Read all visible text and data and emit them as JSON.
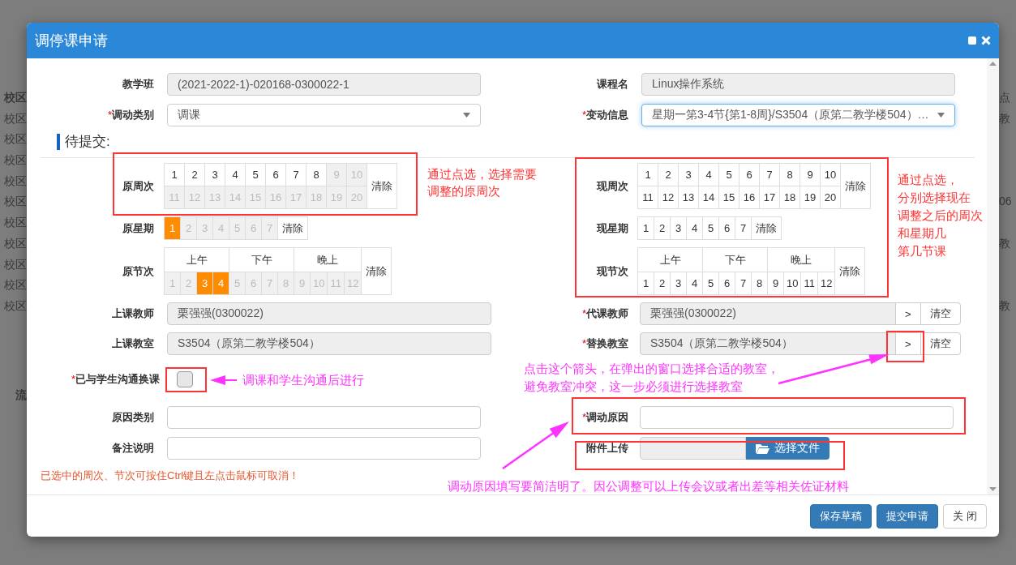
{
  "backdrop": {
    "left_header": "校区",
    "left_rows": [
      "校区",
      "校区",
      "校区",
      "校区",
      "校区",
      "校区",
      "校区",
      "校区",
      "校区",
      "校区"
    ],
    "left_bottom": "流",
    "right_header": "点",
    "right_rows": [
      "教",
      "06",
      "教",
      "教"
    ]
  },
  "dialog": {
    "title": "调停课申请"
  },
  "top_fields": [
    {
      "label": "教学班",
      "kind": "readonly",
      "value": "(2021-2022-1)-020168-0300022-1"
    },
    {
      "label": "课程名",
      "kind": "readonly",
      "value": "Linux操作系统"
    },
    {
      "label": "调动类别",
      "mark": "*",
      "kind": "select",
      "value": "调课",
      "focused": false
    },
    {
      "label": "变动信息",
      "mark": "*",
      "kind": "select",
      "value": "星期一第3-4节{第1-8周}/S3504（原第二教学楼504）…",
      "focused": true
    }
  ],
  "section_title": "待提交:",
  "original": {
    "weeks": {
      "label": "原周次",
      "clear": "清除",
      "items": [
        {
          "label": "1",
          "selected": false,
          "disabled": false
        },
        {
          "label": "2",
          "selected": false,
          "disabled": false
        },
        {
          "label": "3",
          "selected": false,
          "disabled": false
        },
        {
          "label": "4",
          "selected": false,
          "disabled": false
        },
        {
          "label": "5",
          "selected": false,
          "disabled": false
        },
        {
          "label": "6",
          "selected": false,
          "disabled": false
        },
        {
          "label": "7",
          "selected": false,
          "disabled": false
        },
        {
          "label": "8",
          "selected": false,
          "disabled": false
        },
        {
          "label": "9",
          "selected": false,
          "disabled": true
        },
        {
          "label": "10",
          "selected": false,
          "disabled": true
        },
        {
          "label": "11",
          "selected": false,
          "disabled": true
        },
        {
          "label": "12",
          "selected": false,
          "disabled": true
        },
        {
          "label": "13",
          "selected": false,
          "disabled": true
        },
        {
          "label": "14",
          "selected": false,
          "disabled": true
        },
        {
          "label": "15",
          "selected": false,
          "disabled": true
        },
        {
          "label": "16",
          "selected": false,
          "disabled": true
        },
        {
          "label": "17",
          "selected": false,
          "disabled": true
        },
        {
          "label": "18",
          "selected": false,
          "disabled": true
        },
        {
          "label": "19",
          "selected": false,
          "disabled": true
        },
        {
          "label": "20",
          "selected": false,
          "disabled": true
        }
      ]
    },
    "weekday": {
      "label": "原星期",
      "clear": "清除",
      "items": [
        {
          "label": "1",
          "selected": true,
          "disabled": false
        },
        {
          "label": "2",
          "selected": false,
          "disabled": true
        },
        {
          "label": "3",
          "selected": false,
          "disabled": true
        },
        {
          "label": "4",
          "selected": false,
          "disabled": true
        },
        {
          "label": "5",
          "selected": false,
          "disabled": true
        },
        {
          "label": "6",
          "selected": false,
          "disabled": true
        },
        {
          "label": "7",
          "selected": false,
          "disabled": true
        }
      ]
    },
    "periods": {
      "label": "原节次",
      "clear": "清除",
      "groups": [
        "上午",
        "下午",
        "晚上"
      ],
      "items": [
        {
          "label": "1",
          "selected": false,
          "disabled": true
        },
        {
          "label": "2",
          "selected": false,
          "disabled": true
        },
        {
          "label": "3",
          "selected": true,
          "disabled": false
        },
        {
          "label": "4",
          "selected": true,
          "disabled": false
        },
        {
          "label": "5",
          "selected": false,
          "disabled": true
        },
        {
          "label": "6",
          "selected": false,
          "disabled": true
        },
        {
          "label": "7",
          "selected": false,
          "disabled": true
        },
        {
          "label": "8",
          "selected": false,
          "disabled": true
        },
        {
          "label": "9",
          "selected": false,
          "disabled": true
        },
        {
          "label": "10",
          "selected": false,
          "disabled": true
        },
        {
          "label": "11",
          "selected": false,
          "disabled": true
        },
        {
          "label": "12",
          "selected": false,
          "disabled": true
        }
      ]
    }
  },
  "new": {
    "weeks": {
      "label": "现周次",
      "clear": "清除",
      "items": [
        {
          "label": "1",
          "selected": false,
          "disabled": false
        },
        {
          "label": "2",
          "selected": false,
          "disabled": false
        },
        {
          "label": "3",
          "selected": false,
          "disabled": false
        },
        {
          "label": "4",
          "selected": false,
          "disabled": false
        },
        {
          "label": "5",
          "selected": false,
          "disabled": false
        },
        {
          "label": "6",
          "selected": false,
          "disabled": false
        },
        {
          "label": "7",
          "selected": false,
          "disabled": false
        },
        {
          "label": "8",
          "selected": false,
          "disabled": false
        },
        {
          "label": "9",
          "selected": false,
          "disabled": false
        },
        {
          "label": "10",
          "selected": false,
          "disabled": false
        },
        {
          "label": "11",
          "selected": false,
          "disabled": false
        },
        {
          "label": "12",
          "selected": false,
          "disabled": false
        },
        {
          "label": "13",
          "selected": false,
          "disabled": false
        },
        {
          "label": "14",
          "selected": false,
          "disabled": false
        },
        {
          "label": "15",
          "selected": false,
          "disabled": false
        },
        {
          "label": "16",
          "selected": false,
          "disabled": false
        },
        {
          "label": "17",
          "selected": false,
          "disabled": false
        },
        {
          "label": "18",
          "selected": false,
          "disabled": false
        },
        {
          "label": "19",
          "selected": false,
          "disabled": false
        },
        {
          "label": "20",
          "selected": false,
          "disabled": false
        }
      ]
    },
    "weekday": {
      "label": "现星期",
      "clear": "清除",
      "items": [
        {
          "label": "1",
          "selected": false,
          "disabled": false
        },
        {
          "label": "2",
          "selected": false,
          "disabled": false
        },
        {
          "label": "3",
          "selected": false,
          "disabled": false
        },
        {
          "label": "4",
          "selected": false,
          "disabled": false
        },
        {
          "label": "5",
          "selected": false,
          "disabled": false
        },
        {
          "label": "6",
          "selected": false,
          "disabled": false
        },
        {
          "label": "7",
          "selected": false,
          "disabled": false
        }
      ]
    },
    "periods": {
      "label": "现节次",
      "clear": "清除",
      "groups": [
        "上午",
        "下午",
        "晚上"
      ],
      "items": [
        {
          "label": "1",
          "selected": false,
          "disabled": false
        },
        {
          "label": "2",
          "selected": false,
          "disabled": false
        },
        {
          "label": "3",
          "selected": false,
          "disabled": false
        },
        {
          "label": "4",
          "selected": false,
          "disabled": false
        },
        {
          "label": "5",
          "selected": false,
          "disabled": false
        },
        {
          "label": "6",
          "selected": false,
          "disabled": false
        },
        {
          "label": "7",
          "selected": false,
          "disabled": false
        },
        {
          "label": "8",
          "selected": false,
          "disabled": false
        },
        {
          "label": "9",
          "selected": false,
          "disabled": false
        },
        {
          "label": "10",
          "selected": false,
          "disabled": false
        },
        {
          "label": "11",
          "selected": false,
          "disabled": false
        },
        {
          "label": "12",
          "selected": false,
          "disabled": false
        }
      ]
    }
  },
  "people_fields": [
    {
      "label": "上课教师",
      "kind": "readonly",
      "value": "栗强强(0300022)"
    },
    {
      "label": "代课教师",
      "mark": "*",
      "kind": "picker",
      "value": "栗强强(0300022)",
      "pick": ">",
      "clear": "清空"
    },
    {
      "label": "上课教室",
      "kind": "readonly",
      "value": "S3504（原第二教学楼504）"
    },
    {
      "label": "替换教室",
      "mark": "*",
      "kind": "picker",
      "value": "S3504（原第二教学楼504）",
      "pick": ">",
      "clear": "清空"
    }
  ],
  "confirm": {
    "label": "已与学生沟通换课",
    "mark": "*",
    "checked": false
  },
  "reason_fields": [
    {
      "label": "原因类别",
      "kind": "input"
    },
    {
      "label": "调动原因",
      "mark": "*",
      "kind": "input"
    },
    {
      "label": "备注说明",
      "kind": "input"
    },
    {
      "label": "附件上传",
      "kind": "file",
      "button": "选择文件"
    }
  ],
  "note": "已选中的周次、节次可按住Ctrl键且左点击鼠标可取消！",
  "buttons": [
    {
      "label": "保存草稿",
      "kind": "primary"
    },
    {
      "label": "提交申请",
      "kind": "primary"
    },
    {
      "label": "关 闭",
      "kind": "default"
    }
  ],
  "annotations": [
    {
      "lines": [
        "通过点选，选择需要",
        "调整的原周次"
      ],
      "color": "#ff3333"
    },
    {
      "lines": [
        "通过点选，",
        "分别选择现在",
        "调整之后的周次",
        "和星期几",
        "第几节课"
      ],
      "color": "#ff3333"
    },
    {
      "lines": [
        "调课和学生沟通后进行"
      ],
      "color": "#ff33ff"
    },
    {
      "lines": [
        "点击这个箭头，在弹出的窗口选择合适的教室，",
        "避免教室冲突，这一步必须进行选择教室"
      ],
      "color": "#ff33ff"
    },
    {
      "lines": [
        "调动原因填写要简洁明了。因公调整可以上传会议或者出差等相关佐证材料"
      ],
      "color": "#ff33ff"
    }
  ]
}
